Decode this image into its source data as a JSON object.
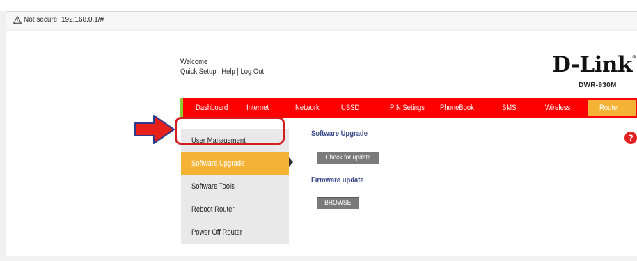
{
  "browser": {
    "security_label": "Not secure",
    "url": "192.168.0.1/#"
  },
  "header": {
    "welcome": "Welcome",
    "links": [
      "Quick Setup",
      "Help",
      "Log Out"
    ],
    "separator": " | ",
    "logo": "D-Link",
    "logo_mark": "®",
    "model": "DWR-930M"
  },
  "nav": {
    "items": [
      "Dashboard",
      "Internet",
      "Network",
      "USSD",
      "PIN Setings",
      "PhoneBook",
      "SMS",
      "Wireless",
      "Router"
    ],
    "active": "Router",
    "colors": {
      "bar": "#ff0000",
      "active": "#f5b336",
      "accent": "#8ccc32"
    }
  },
  "sidebar": {
    "items": [
      "User Management",
      "Software Upgrade",
      "Software Tools",
      "Reboot Router",
      "Power Off Router"
    ],
    "active": "Software Upgrade"
  },
  "main": {
    "software_upgrade_title": "Software Upgrade",
    "check_button": "Check for update",
    "firmware_title": "Firmware update",
    "browse_button": "BROWSE"
  },
  "help_label": "?",
  "annotation": {
    "arrow_color": "#e8201a",
    "ring_color": "#d21f1f"
  }
}
